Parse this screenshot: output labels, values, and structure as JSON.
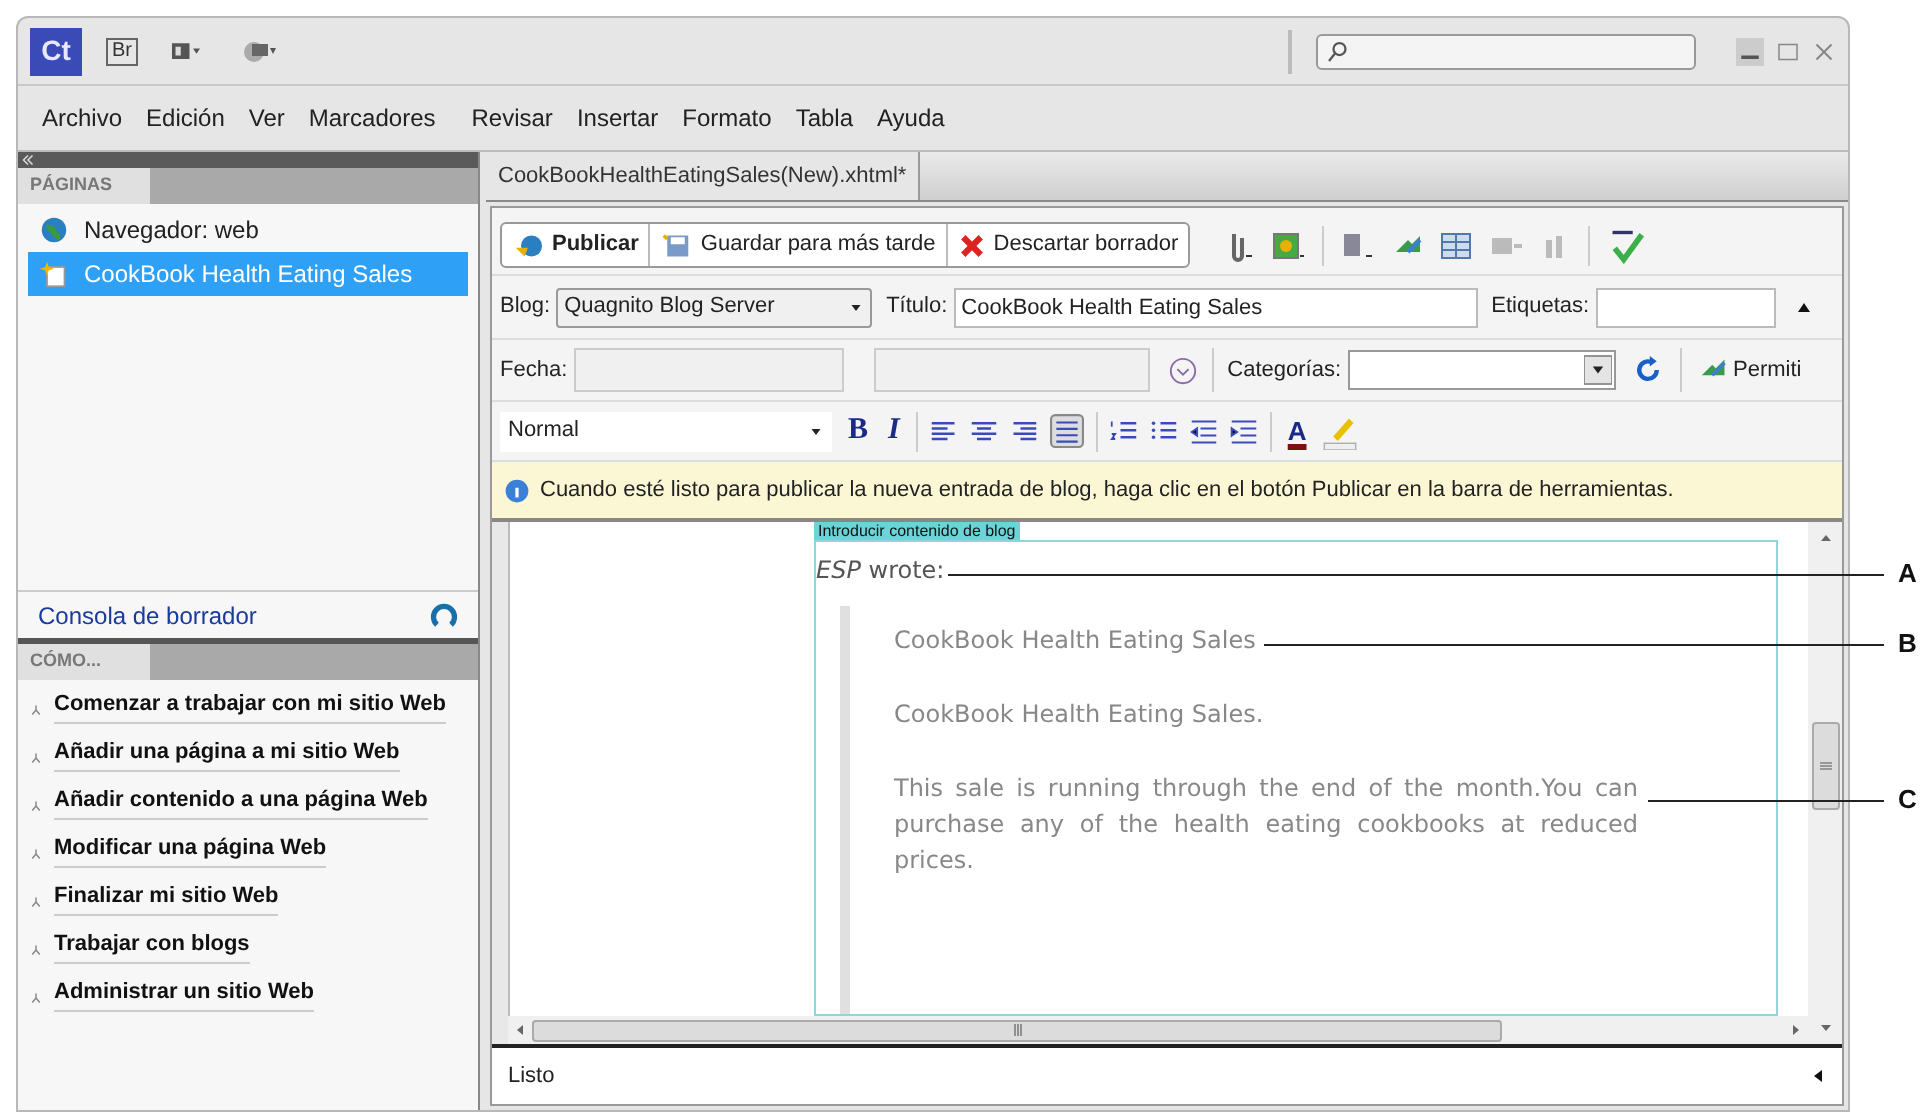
{
  "app_bar": {
    "logo": "Ct",
    "bridge": "Br"
  },
  "menu": [
    "Archivo",
    "Edición",
    "Ver",
    "Marcadores",
    "Revisar",
    "Insertar",
    "Formato",
    "Tabla",
    "Ayuda"
  ],
  "pages_panel": {
    "title": "PÁGINAS",
    "items": [
      {
        "label": "Navegador: web",
        "kind": "globe",
        "selected": false
      },
      {
        "label": "CookBook Health Eating Sales",
        "kind": "page",
        "selected": true
      }
    ],
    "footer_link": "Consola de borrador"
  },
  "howto_panel": {
    "title": "CÓMO...",
    "links": [
      "Comenzar a trabajar con mi sitio Web",
      "Añadir una página a mi sitio Web",
      "Añadir contenido a una página Web",
      "Modificar una página Web",
      "Finalizar mi sitio Web",
      "Trabajar con blogs",
      "Administrar un sitio Web"
    ]
  },
  "document_tab": "CookBookHealthEatingSales(New).xhtml*",
  "toolbar": [
    {
      "label": "Publicar",
      "kind": "publish",
      "emphasis": true
    },
    {
      "label": "Guardar para más tarde",
      "kind": "save",
      "emphasis": false
    },
    {
      "label": "Descartar borrador",
      "kind": "discard",
      "emphasis": false
    }
  ],
  "form": {
    "blog_label": "Blog:",
    "blog_value": "Quagnito Blog Server",
    "title_label": "Título:",
    "title_value": "CookBook Health Eating Sales",
    "tags_label": "Etiquetas:",
    "date_label": "Fecha:",
    "categories_label": "Categorías:",
    "permit_label": "Permiti"
  },
  "format_bar": {
    "style": "Normal",
    "bold": "B",
    "italic": "I",
    "font_color": "A"
  },
  "info_bar": "Cuando esté listo para publicar la nueva entrada de blog, haga clic en el botón Publicar en la barra de herramientas.",
  "editor": {
    "content_label": "Introducir contenido de blog",
    "byline": "*ESP* wrote:",
    "quote": [
      "CookBook Health Eating Sales",
      "CookBook Health Eating Sales.",
      "This sale is running through the end of the month.You can purchase any of the health eating cookbooks at reduced prices."
    ]
  },
  "status_bar": "Listo",
  "callouts": [
    "A",
    "B",
    "C"
  ]
}
